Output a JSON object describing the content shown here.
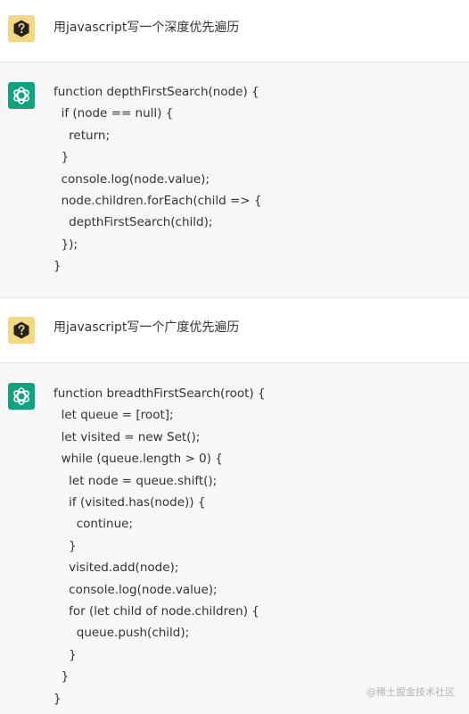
{
  "conversation": [
    {
      "role": "user",
      "avatar_icon": "question-mark-icon",
      "text": "用javascript写一个深度优先遍历"
    },
    {
      "role": "assistant",
      "avatar_icon": "openai-logo-icon",
      "code_lines": [
        "function depthFirstSearch(node) {",
        "  if (node == null) {",
        "    return;",
        "  }",
        "  console.log(node.value);",
        "  node.children.forEach(child => {",
        "    depthFirstSearch(child);",
        "  });",
        "}"
      ]
    },
    {
      "role": "user",
      "avatar_icon": "question-mark-icon",
      "text": "用javascript写一个广度优先遍历"
    },
    {
      "role": "assistant",
      "avatar_icon": "openai-logo-icon",
      "code_lines": [
        "function breadthFirstSearch(root) {",
        "  let queue = [root];",
        "  let visited = new Set();",
        "  while (queue.length > 0) {",
        "    let node = queue.shift();",
        "    if (visited.has(node)) {",
        "      continue;",
        "    }",
        "    visited.add(node);",
        "    console.log(node.value);",
        "    for (let child of node.children) {",
        "      queue.push(child);",
        "    }",
        "  }",
        "}"
      ]
    }
  ],
  "watermark": "@稀土掘金技术社区",
  "colors": {
    "user_avatar_bg": "#f3d87f",
    "bot_avatar_bg": "#10a37f",
    "assistant_row_bg": "#f7f7f8"
  }
}
